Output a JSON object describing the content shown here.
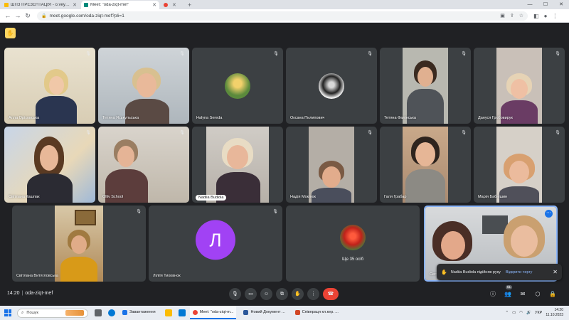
{
  "browser": {
    "tabs": [
      {
        "label": "ШПЗ ПРЕЗЕНТАЦІЯ - o.veykk@...",
        "icon_color": "#fbbc04",
        "active": false
      },
      {
        "label": "Meet: \"oda-ziqt-mef\"",
        "icon_color": "#00897b",
        "active": true
      },
      {
        "label": "",
        "icon_color": "#ea4335",
        "active": false
      }
    ],
    "url": "meet.google.com/oda-ziqt-mef?pli=1"
  },
  "participants": [
    {
      "name": "Алла Оріховська",
      "mic_muted": true
    },
    {
      "name": "Тетяна Яськульська",
      "mic_muted": true
    },
    {
      "name": "Halyna Sereda",
      "mic_muted": true
    },
    {
      "name": "Оксана Пилипович",
      "mic_muted": true
    },
    {
      "name": "Тетяна Фалінська",
      "mic_muted": true
    },
    {
      "name": "Дануся Гробовирук",
      "mic_muted": true
    },
    {
      "name": "Світлана Кашпак",
      "mic_muted": true
    },
    {
      "name": "Olliv School",
      "mic_muted": true
    },
    {
      "name": "Nadiia Budiola",
      "mic_muted": false,
      "speaking": true
    },
    {
      "name": "Надія Моклюк",
      "mic_muted": true
    },
    {
      "name": "Галя Грабар",
      "mic_muted": true
    },
    {
      "name": "Марія Бабнішин",
      "mic_muted": true
    },
    {
      "name": "Світлана Витягловська",
      "mic_muted": true
    },
    {
      "name": "Ліліїя Тиховнок",
      "mic_muted": true,
      "initial": "Л"
    },
    {
      "name": "Ще 35 осіб",
      "mic_muted": false
    },
    {
      "name": "Сесі",
      "mic_muted": false
    }
  ],
  "toast": {
    "message": "Nadiia Budiola підійняв руку",
    "action": "Відкрити чергу"
  },
  "meeting": {
    "time": "14:20",
    "code": "oda-ziqt-mef",
    "participant_count": "51"
  },
  "taskbar": {
    "search_placeholder": "Пошук",
    "items": [
      {
        "label": "Завантаження",
        "icon_color": "#1a73e8",
        "active": false
      },
      {
        "label": "Meet: \"oda-ziqt-m...",
        "icon_color": "#ea4335",
        "active": true
      },
      {
        "label": "Новий Документ ...",
        "icon_color": "#2b579a",
        "active": false
      },
      {
        "label": "Співпраця кл.кер. ...",
        "icon_color": "#d24726",
        "active": false
      }
    ],
    "lang": "УКР",
    "clock_time": "14:20",
    "clock_date": "11.10.2023"
  },
  "colors": {
    "meet_bg": "#202124",
    "tile_bg": "#3c4043",
    "end_call": "#ea4335",
    "accent_blue": "#8ab4f8",
    "avatar_purple": "#a142f4"
  }
}
